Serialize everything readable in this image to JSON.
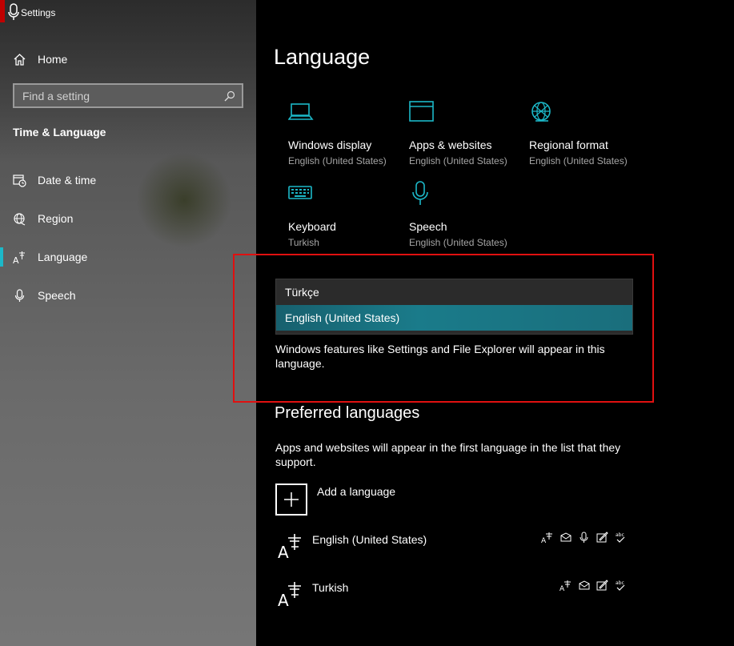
{
  "window": {
    "title": "Settings"
  },
  "sidebar": {
    "home_label": "Home",
    "search_placeholder": "Find a setting",
    "section_title": "Time & Language",
    "items": [
      {
        "label": "Date & time",
        "icon": "calendar-clock-icon"
      },
      {
        "label": "Region",
        "icon": "globe-icon"
      },
      {
        "label": "Language",
        "icon": "language-icon",
        "selected": true
      },
      {
        "label": "Speech",
        "icon": "microphone-icon"
      }
    ]
  },
  "main": {
    "title": "Language",
    "tiles": [
      {
        "name": "Windows display",
        "sub": "English (United States)",
        "icon": "laptop-icon"
      },
      {
        "name": "Apps & websites",
        "sub": "English (United States)",
        "icon": "browser-window-icon"
      },
      {
        "name": "Regional format",
        "sub": "English (United States)",
        "icon": "globe-icon"
      },
      {
        "name": "Keyboard",
        "sub": "Turkish",
        "icon": "keyboard-icon"
      },
      {
        "name": "Speech",
        "sub": "English (United States)",
        "icon": "microphone-icon"
      }
    ],
    "display_language": {
      "options": [
        "Türkçe",
        "English (United States)"
      ],
      "selected": "English (United States)",
      "description": "Windows features like Settings and File Explorer will appear in this language."
    },
    "preferred": {
      "title": "Preferred languages",
      "description": "Apps and websites will appear in the first language in the list that they support.",
      "add_label": "Add a language",
      "languages": [
        {
          "name": "English (United States)",
          "features": [
            "display-language-icon",
            "text-to-speech-icon",
            "speech-recognition-icon",
            "handwriting-icon",
            "spell-check-icon"
          ]
        },
        {
          "name": "Turkish",
          "features": [
            "display-language-icon",
            "text-to-speech-icon",
            "handwriting-icon",
            "spell-check-icon"
          ]
        }
      ]
    }
  },
  "colors": {
    "accent": "#1cb8c8",
    "highlight_border": "#e01010",
    "selected_option": "#1a7b8a"
  }
}
